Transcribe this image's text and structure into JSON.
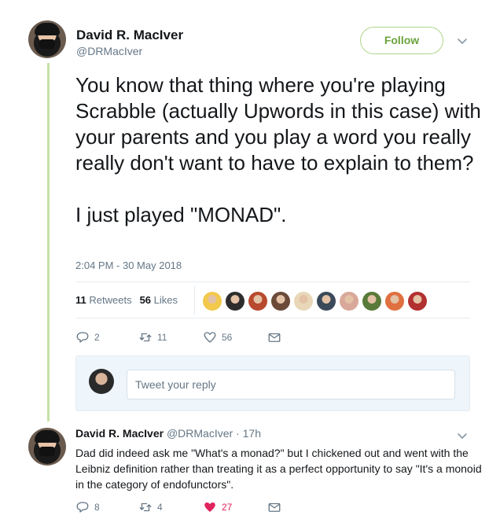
{
  "tweet": {
    "author_name": "David R. MacIver",
    "author_handle": "@DRMacIver",
    "follow_label": "Follow",
    "text": "You know that thing where you're playing Scrabble (actually Upwords in this case) with your parents and you play a word you really really don't want to have to explain to them?\n\nI just played \"MONAD\".",
    "timestamp": "2:04 PM - 30 May 2018",
    "retweets_count": "11",
    "retweets_label": "Retweets",
    "likes_count": "56",
    "likes_label": "Likes",
    "liker_colors": [
      "#f2c94c",
      "#2d2d2d",
      "#b84a2e",
      "#6b4a3a",
      "#e8d8b8",
      "#3b4a5a",
      "#d9a89a",
      "#5a7a3a",
      "#e07040",
      "#b33030"
    ],
    "actions": {
      "reply_count": "2",
      "retweet_count": "11",
      "like_count": "56"
    }
  },
  "reply_box": {
    "placeholder": "Tweet your reply"
  },
  "reply": {
    "author_name": "David R. MacIver",
    "author_handle": "@DRMacIver",
    "time": "17h",
    "text": "Dad did indeed ask me \"What's a monad?\" but I chickened out and went with the Leibniz definition rather than treating it as a perfect opportunity to say \"It's a monoid in the category of endofunctors\".",
    "actions": {
      "reply_count": "8",
      "retweet_count": "4",
      "like_count": "27"
    }
  },
  "colors": {
    "accent": "#6aa33c",
    "thread_line": "#c5e1a5",
    "liked": "#e0245e",
    "muted": "#657786"
  }
}
